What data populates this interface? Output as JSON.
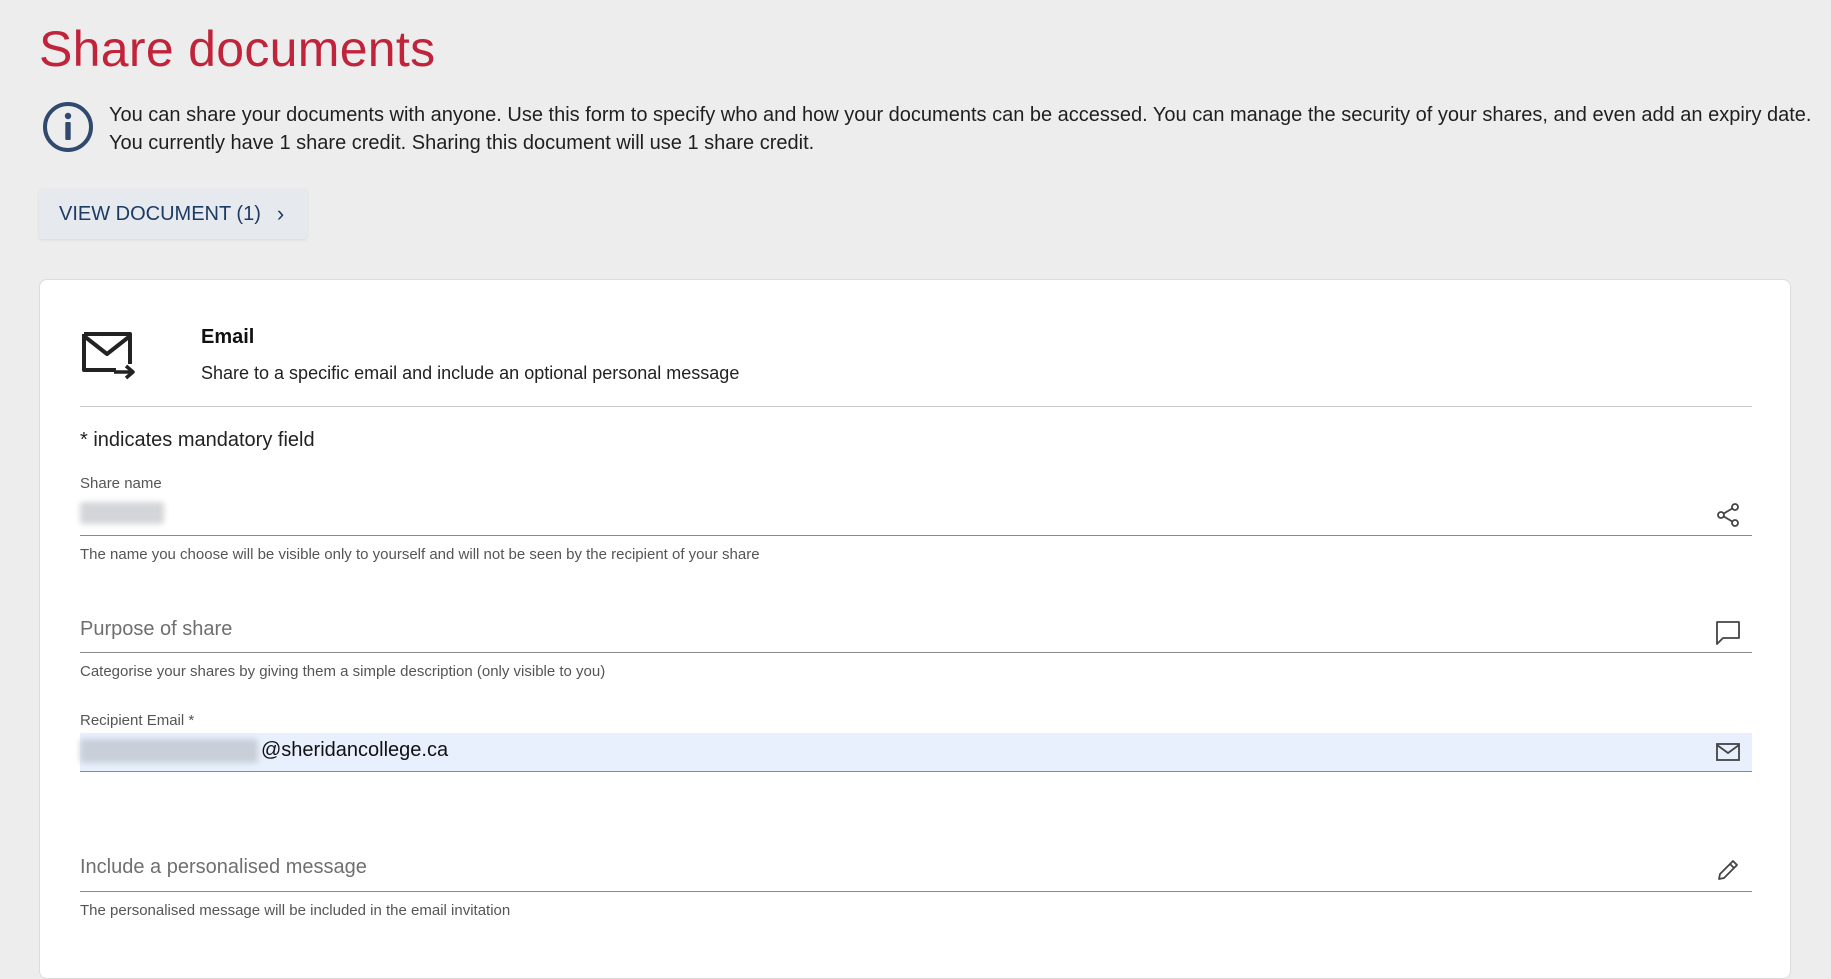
{
  "page": {
    "title": "Share documents"
  },
  "info": {
    "icon": "info-circle-icon",
    "line1": "You can share your documents with anyone. Use this form to specify who and how your documents can be accessed. You can manage the security of your shares, and even add an expiry date.",
    "line2": "You currently have 1 share credit. Sharing this document will use 1 share credit."
  },
  "view_document": {
    "label": "VIEW DOCUMENT (1)",
    "icon": "chevron-right-icon"
  },
  "email_card": {
    "icon": "email-send-icon",
    "title": "Email",
    "subtitle": "Share to a specific email and include an optional personal message",
    "mandatory_note": "* indicates mandatory field"
  },
  "fields": {
    "share_name": {
      "label": "Share name",
      "hint": "The name you choose will be visible only to yourself and will not be seen by the recipient of your share",
      "icon": "share-icon"
    },
    "purpose": {
      "placeholder": "Purpose of share",
      "hint": "Categorise your shares by giving them a simple description (only visible to you)",
      "icon": "comment-icon"
    },
    "recipient_email": {
      "label": "Recipient Email *",
      "domain": "@sheridancollege.ca",
      "icon": "envelope-icon"
    },
    "message": {
      "placeholder": "Include a personalised message",
      "hint": "The personalised message will be included in the email invitation",
      "icon": "pencil-icon"
    }
  },
  "colors": {
    "title_red": "#c0243a",
    "navy": "#1d3b63",
    "email_field_bg": "#e8f0fd",
    "page_bg": "#ededed"
  }
}
